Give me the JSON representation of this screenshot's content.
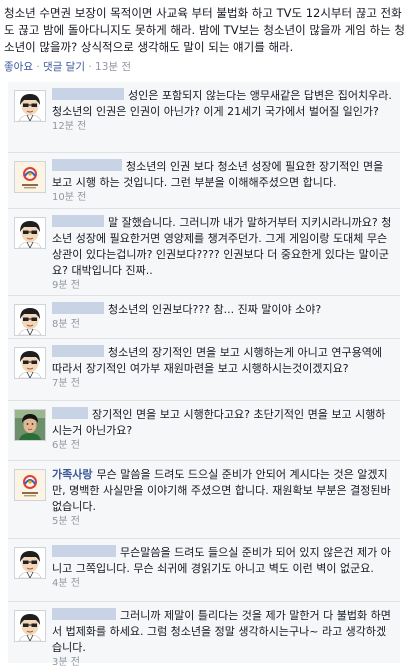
{
  "post": {
    "text": "청소년 수면권 보장이 목적이면 사교육 부터 불법화 하고 TV도 12시부터 끊고 전화도 끊고 밤에 돌아다니지도 못하게 해라. 밤에 TV보는 청소년이 많을까 게임 하는 청소년이 많을까? 상식적으로 생각해도 말이 되는 얘기를 해라.",
    "like_label": "좋아요",
    "comment_label": "댓글 달기",
    "time": "13분 전"
  },
  "comments": [
    {
      "author": "",
      "text": "성인은 포함되지 않는다는 앵무새같은 답변은 집어치우라. 청소년의 인권은 인권이 아닌가? 이게 21세기 국가에서 벌어질 일인가?",
      "time": "12분 전",
      "avatar": "cartoon-boy-avatar"
    },
    {
      "author": "",
      "text": "청소년의 인권 보다 청소년 성장에 필요한 장기적인 면을 보고 시행 하는 것입니다. 그런 부분을 이해해주셨으면 합니다.",
      "time": "10분 전",
      "avatar": "ministry-logo-avatar"
    },
    {
      "author": "",
      "text": "말 잘했습니다. 그러니까 내가 말하거부터 지키시라니까요? 청소년 성장에 필요한거면 영양제를 챙겨주던가. 그게 게임이랑 도대체 무슨 상관이 있다는겁니까? 인권보다???? 인권보다 더 중요한게 있다는 말이군요? 대박입니다 진짜..",
      "time": "9분 전",
      "avatar": "cartoon-boy-avatar"
    },
    {
      "author": "",
      "text": "청소년의 인권보다??? 참... 진짜 말이야 소야?",
      "time": "8분 전",
      "avatar": "cartoon-boy-avatar"
    },
    {
      "author": "",
      "text": "청소년의 장기적인 면을 보고 시행하는게 아니고 연구용역에 따라서 장기적인 여가부 재원마련을 보고 시행하시는것이겠지요?",
      "time": "7분 전",
      "avatar": "cartoon-boy-avatar"
    },
    {
      "author": "",
      "text": "장기적인 면을 보고 시행한다고요? 초단기적인 면을 보고 시행하시는거 아닌가요?",
      "time": "6분 전",
      "avatar": "photo-avatar"
    },
    {
      "author": "가족사랑",
      "text": "무슨 말씀을 드려도 드으실 준비가 안되어 계시다는 것은 알겠지만, 명백한 사실만을 이야기해 주셨으면 합니다. 재원확보 부분은 결정된바 없습니다.",
      "time": "5분 전",
      "avatar": "ministry-logo-avatar"
    },
    {
      "author": "",
      "text": "무슨말씀을 드려도 들으실 준비가 되어 있지 않은건 제가 아니고 그쪽입니다. 무슨 쇠귀에 경읽기도 아니고 벽도 이런 벽이 없군요.",
      "time": "4분 전",
      "avatar": "cartoon-boy-avatar"
    },
    {
      "author": "",
      "text": "그러니까 제말이 틀리다는 것을 제가 말한거 다 불법화 하면서 법제화를 하세요. 그럼 청소년을 정말 생각하시는구나~ 라고 생각하겠습니다.",
      "time": "3분 전",
      "avatar": "cartoon-boy-avatar"
    }
  ]
}
